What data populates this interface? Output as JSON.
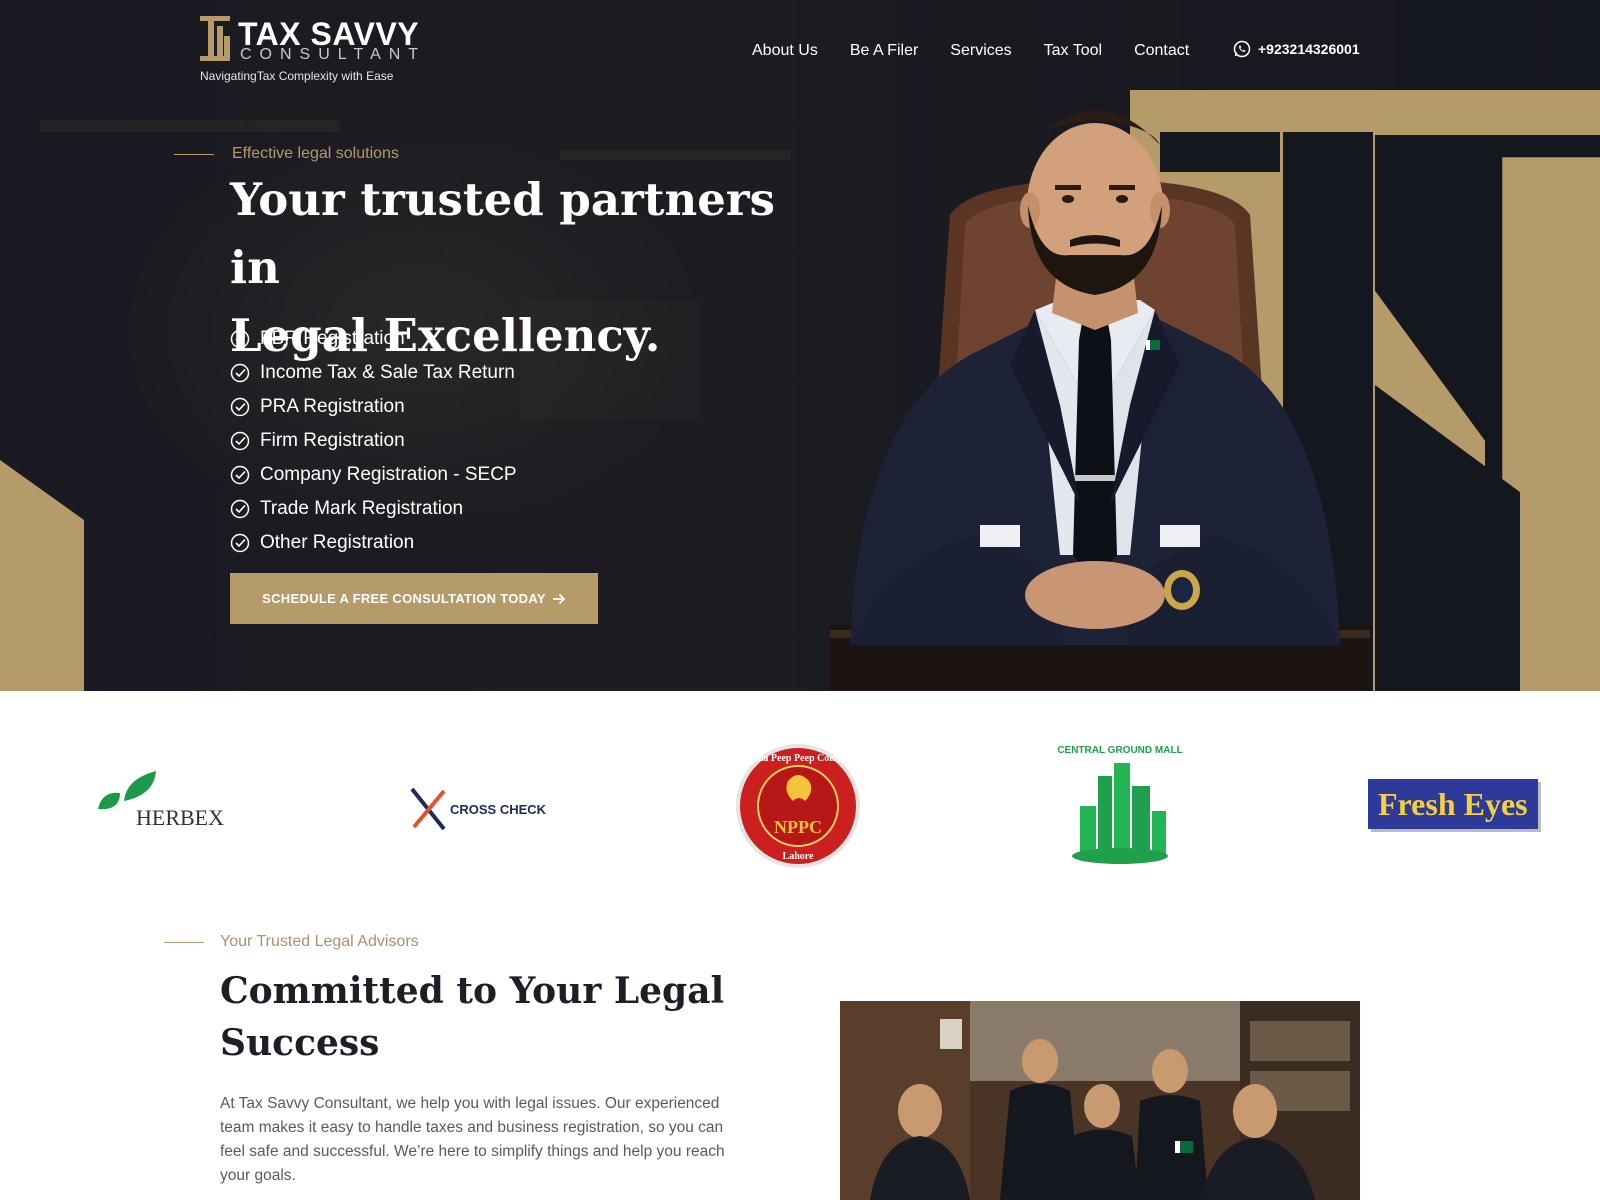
{
  "brand": {
    "name": "TAX SAVVY",
    "sub": "CONSULTANT",
    "tagline": "NavigatingTax Complexity with Ease"
  },
  "nav": [
    {
      "label": "About Us"
    },
    {
      "label": "Be A Filer"
    },
    {
      "label": "Services"
    },
    {
      "label": "Tax Tool"
    },
    {
      "label": "Contact"
    }
  ],
  "phone": "+923214326001",
  "hero": {
    "eyebrow": "Effective legal solutions",
    "title_line1": "Your trusted partners in",
    "title_line2": "Legal Excellency.",
    "services": [
      "FBR Registration",
      "Income Tax & Sale Tax Return",
      "PRA Registration",
      "Firm Registration",
      "Company Registration - SECP",
      "Trade Mark Registration",
      "Other Registration"
    ],
    "cta": "SCHEDULE A FREE CONSULTATION TODAY"
  },
  "clients": {
    "herbex": "HERBEX",
    "crosscheck": "CROSS CHECK",
    "nppc": "NPPC",
    "nppc_ring": "Nabiha Peep Peep Company",
    "nppc_city": "Lahore",
    "central": "CENTRAL GROUND MALL",
    "fresheyes": "Fresh Eyes"
  },
  "about": {
    "eyebrow": "Your Trusted Legal Advisors",
    "title": "Committed to Your Legal Success",
    "text": "At Tax Savvy Consultant, we help you with legal issues. Our experienced team makes it easy to handle taxes and business registration, so you can feel safe and successful. We’re here to simplify things and help you reach your goals."
  },
  "colors": {
    "gold": "#b59a6a",
    "dark": "#15171f",
    "white": "#ffffff"
  },
  "icons": [
    "whatsapp-icon",
    "check-circle-icon",
    "arrow-right-icon"
  ]
}
